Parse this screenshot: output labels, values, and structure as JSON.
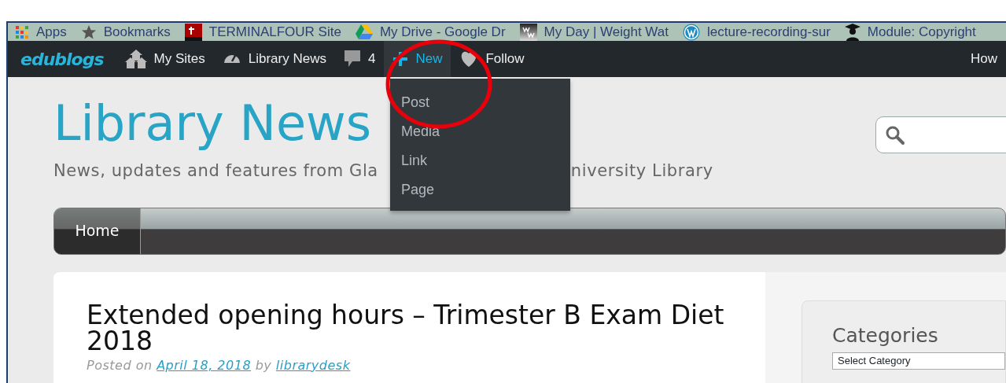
{
  "bookmarks": [
    {
      "label": "Apps"
    },
    {
      "label": "Bookmarks"
    },
    {
      "label": "TERMINALFOUR Site"
    },
    {
      "label": "My Drive - Google Dr"
    },
    {
      "label": "My Day | Weight Wat"
    },
    {
      "label": "lecture-recording-sur"
    },
    {
      "label": "Module: Copyright"
    }
  ],
  "admin_bar": {
    "logo": "edublogs",
    "items": [
      {
        "label": "My Sites",
        "selected": false
      },
      {
        "label": "Library News",
        "selected": false
      },
      {
        "label": "4",
        "selected": false
      },
      {
        "label": "New",
        "selected": true
      },
      {
        "label": "Follow",
        "selected": false
      }
    ],
    "right_label": "How"
  },
  "new_menu": [
    "Post",
    "Media",
    "Link",
    "Page"
  ],
  "site": {
    "title": "Library News",
    "tagline_parts": [
      "News, updates and features from Gla",
      "niversity Library"
    ]
  },
  "nav": [
    {
      "label": "Home",
      "selected": true
    }
  ],
  "post": {
    "title": "Extended opening hours – Trimester B Exam Diet 2018",
    "posted_on": "Posted on",
    "date": "April 18, 2018",
    "by": "by",
    "author": "librarydesk"
  },
  "sidebar": {
    "heading": "Categories",
    "select": "Select Category"
  }
}
